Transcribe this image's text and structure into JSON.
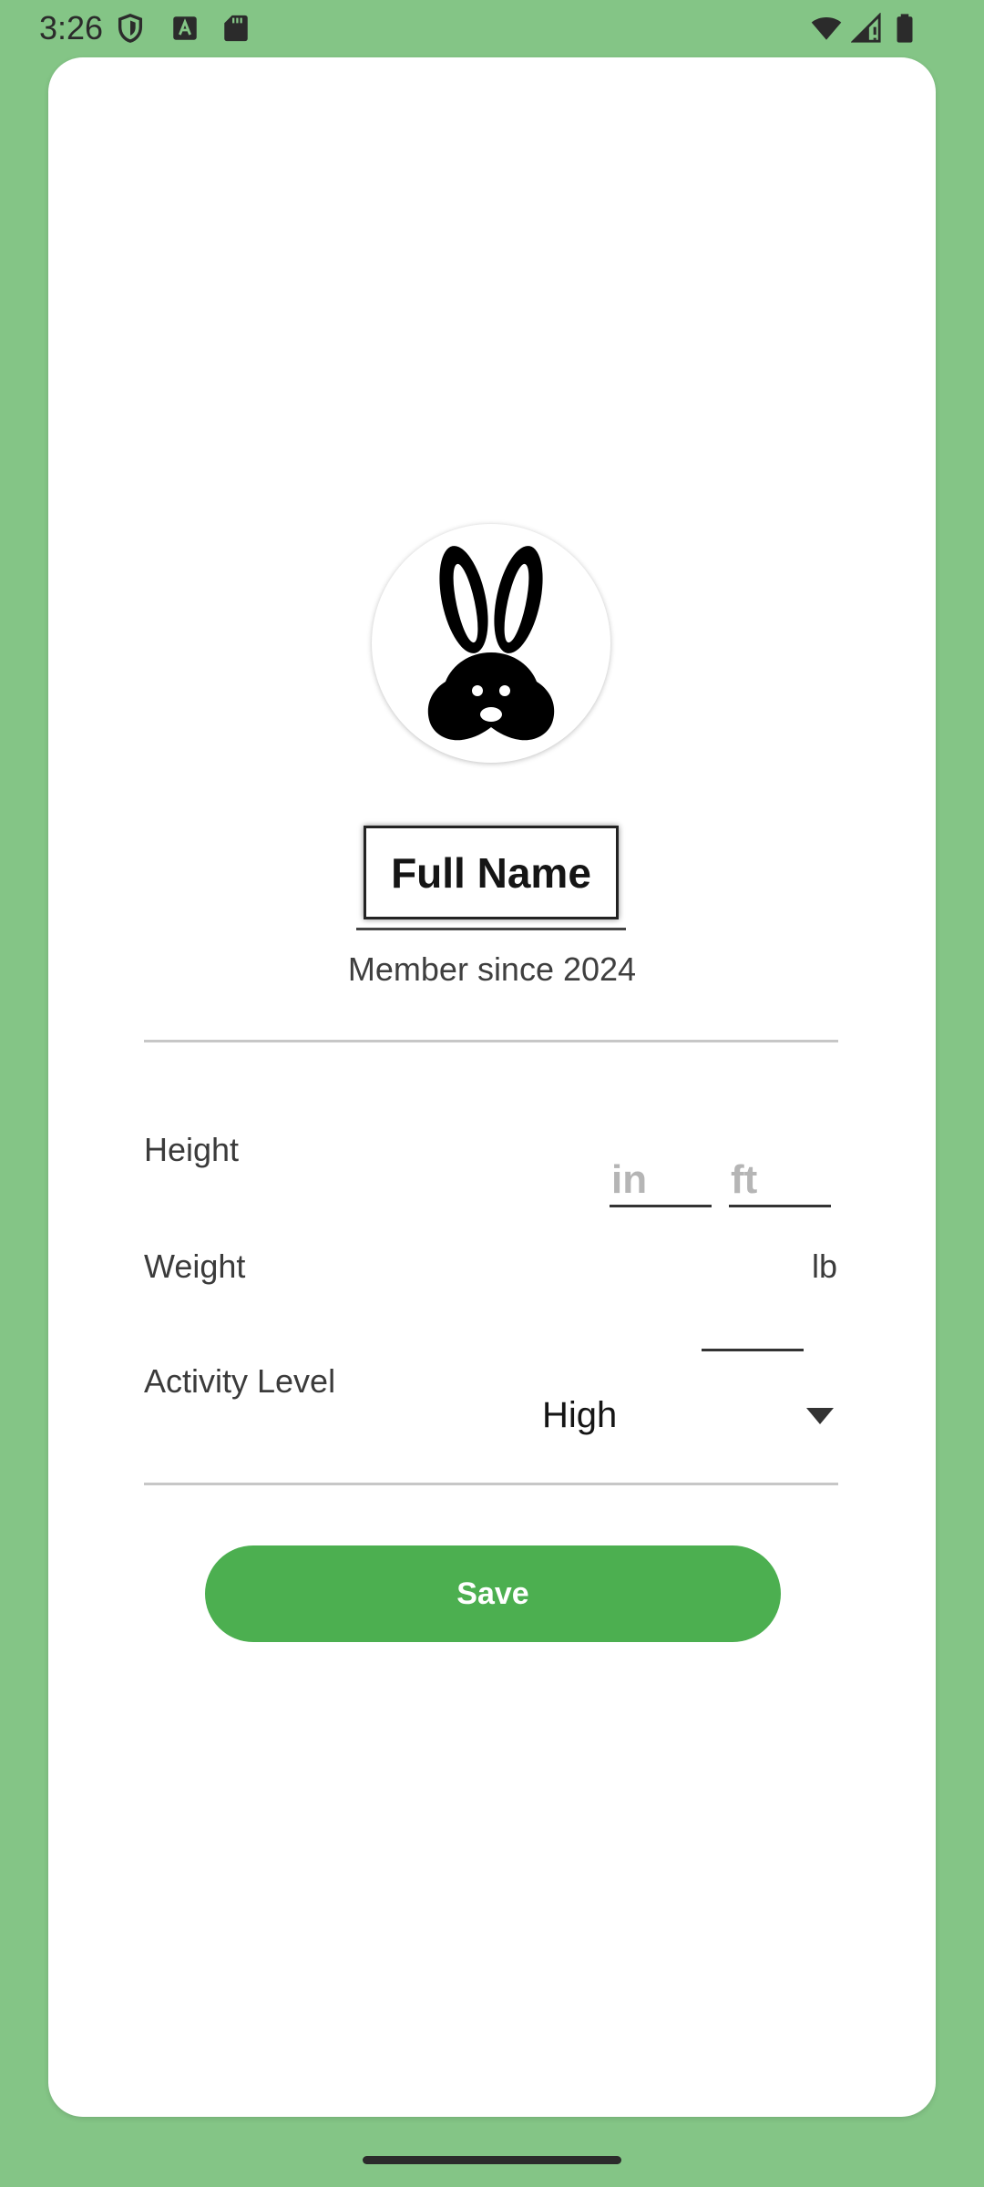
{
  "status_bar": {
    "time": "3:26",
    "left_icons": [
      "shield-icon",
      "text-a-icon",
      "sd-card-icon"
    ],
    "right_icons": [
      "wifi-icon",
      "signal-icon",
      "battery-icon"
    ]
  },
  "profile": {
    "avatar_icon": "bunny-icon",
    "name": "Full Name",
    "member_since": "Member since 2024"
  },
  "form": {
    "height": {
      "label": "Height",
      "inches_placeholder": "in",
      "feet_placeholder": "ft"
    },
    "weight": {
      "label": "Weight",
      "value": "",
      "unit": "lb"
    },
    "activity": {
      "label": "Activity Level",
      "selected": "High"
    }
  },
  "actions": {
    "save_label": "Save"
  },
  "colors": {
    "background": "#84c586",
    "card": "#ffffff",
    "accent": "#4caf50"
  }
}
